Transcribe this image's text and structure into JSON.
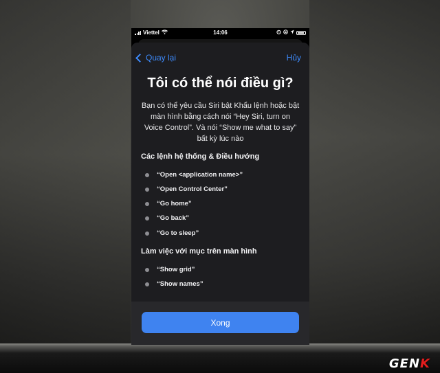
{
  "status_bar": {
    "carrier": "Viettel",
    "time": "14:06"
  },
  "nav": {
    "back_label": "Quay lại",
    "cancel_label": "Hủy"
  },
  "title": "Tôi có thể nói điều gì?",
  "description": "Bạn có thể yêu cầu Siri bật Khẩu lệnh hoặc bật màn hình bằng cách nói “Hey Siri, turn on Voice Control”. Và nói “Show me what to say” bất kỳ lúc nào",
  "sections": [
    {
      "heading": "Các lệnh hệ thống & Điều hướng",
      "commands": [
        "“Open <application name>”",
        "“Open Control Center”",
        "“Go home”",
        "“Go back”",
        "“Go to sleep”"
      ]
    },
    {
      "heading": "Làm việc với mục trên màn hình",
      "commands": [
        "“Show grid”",
        "“Show names”"
      ]
    }
  ],
  "done_label": "Xong",
  "watermark": {
    "prefix": "GEN",
    "suffix": "K"
  },
  "colors": {
    "accent": "#3d8bfd",
    "button": "#3f83f0",
    "sheet_bg": "#1d1d20"
  }
}
